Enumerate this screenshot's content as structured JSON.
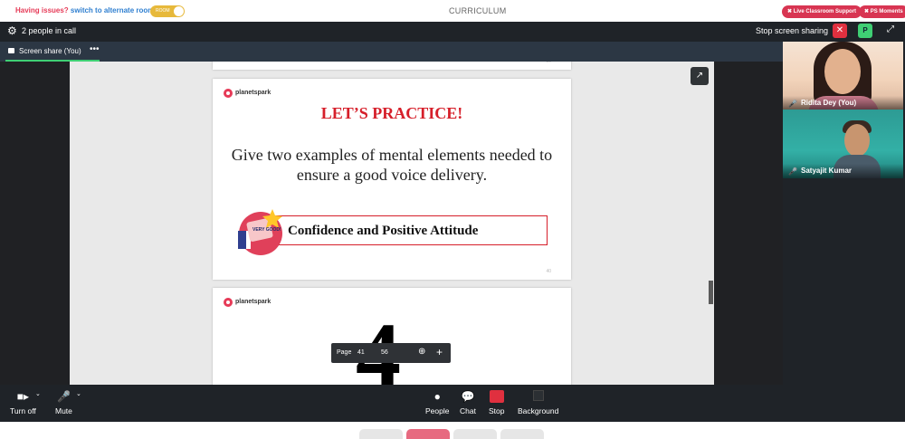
{
  "topbar": {
    "issues_q": "Having issues?",
    "issues_link": "switch to alternate room",
    "room_toggle_label": "ROOM",
    "center_title": "CURRICULUM",
    "live_support": "✖ Live Classroom Support",
    "ps_moments": "✖ PS Moments"
  },
  "call": {
    "people_count": "2 people in call",
    "stop_sharing": "Stop screen sharing",
    "stop_x": "✕",
    "p_badge": "P",
    "tab_label": "Screen share (You)",
    "tab_more": "•••"
  },
  "viewer": {
    "prev_page_num": "39",
    "logo_text": "planetspark",
    "slide_heading": "LET’S PRACTICE!",
    "slide_body": "Give two examples of mental elements needed to ensure a good voice delivery.",
    "answer": "Confidence and Positive Attitude",
    "badge_text": "VERY GOOD!",
    "page_num": "40",
    "next_logo_text": "planetspark",
    "next_big": "4",
    "popout_icon": "↗",
    "pagebar": {
      "label": "Page",
      "current": "41",
      "total": "56",
      "zoom_icon": "⊕",
      "plus_icon": "+"
    }
  },
  "participants": [
    {
      "name": "Ridita Dey (You)"
    },
    {
      "name": "Satyajit Kumar"
    }
  ],
  "controls": {
    "camera_label": "Turn off",
    "mic_label": "Mute",
    "people_label": "People",
    "chat_label": "Chat",
    "stop_label": "Stop",
    "background_label": "Background"
  },
  "colors": {
    "accent_red": "#e63a57",
    "link_blue": "#2f7fd0",
    "call_bg": "#1f2328",
    "green": "#3fcf74",
    "slide_red": "#d61f2a"
  }
}
